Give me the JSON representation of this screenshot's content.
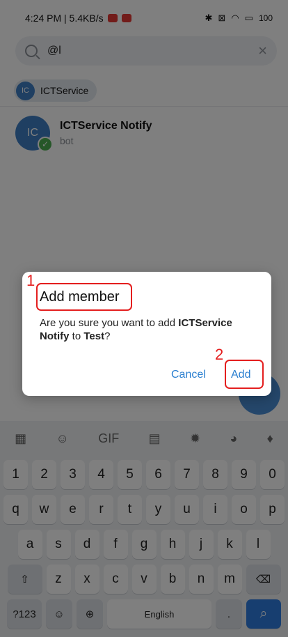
{
  "status_bar": {
    "left_text": "4:24 PM | 5.4KB/s",
    "battery": "100"
  },
  "search": {
    "value": "@l"
  },
  "chip": {
    "avatar_initials": "IC",
    "label": "ICTService"
  },
  "result": {
    "avatar_initials": "IC",
    "title": "ICTService Notify",
    "subtitle": "bot"
  },
  "dialog": {
    "title": "Add member",
    "body_prefix": "Are you sure you want to add ",
    "bot_name": "ICTService Notify",
    "body_middle": " to ",
    "group_name": "Test",
    "body_suffix": "?",
    "cancel_label": "Cancel",
    "add_label": "Add"
  },
  "annotations": {
    "marker_1": "1",
    "marker_2": "2"
  },
  "keyboard": {
    "toolbar_gif": "GIF",
    "numbers": [
      "1",
      "2",
      "3",
      "4",
      "5",
      "6",
      "7",
      "8",
      "9",
      "0"
    ],
    "row1": [
      "q",
      "w",
      "e",
      "r",
      "t",
      "y",
      "u",
      "i",
      "o",
      "p"
    ],
    "row2": [
      "a",
      "s",
      "d",
      "f",
      "g",
      "h",
      "j",
      "k",
      "l"
    ],
    "row3": [
      "z",
      "x",
      "c",
      "v",
      "b",
      "n",
      "m"
    ],
    "symbols_label": "?123",
    "space_label": "English",
    "period_label": "."
  },
  "colors": {
    "accent": "#2a7fd0",
    "annotation": "#e41e1e",
    "avatar": "#3f7fc4",
    "verified": "#4caf50"
  }
}
